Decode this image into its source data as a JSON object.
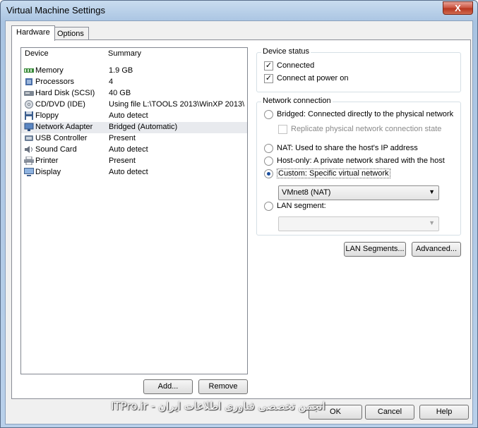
{
  "window": {
    "title": "Virtual Machine Settings",
    "close_label": "X"
  },
  "tabs": [
    {
      "label": "Hardware"
    },
    {
      "label": "Options"
    }
  ],
  "device_list": {
    "col_device": "Device",
    "col_summary": "Summary",
    "items": [
      {
        "name": "Memory",
        "summary": "1.9 GB",
        "icon": "memory-icon"
      },
      {
        "name": "Processors",
        "summary": "4",
        "icon": "processor-icon"
      },
      {
        "name": "Hard Disk (SCSI)",
        "summary": "40 GB",
        "icon": "hard-disk-icon"
      },
      {
        "name": "CD/DVD (IDE)",
        "summary": "Using file L:\\TOOLS 2013\\WinXP 2013\\...",
        "icon": "cd-dvd-icon"
      },
      {
        "name": "Floppy",
        "summary": "Auto detect",
        "icon": "floppy-icon"
      },
      {
        "name": "Network Adapter",
        "summary": "Bridged (Automatic)",
        "icon": "network-adapter-icon"
      },
      {
        "name": "USB Controller",
        "summary": "Present",
        "icon": "usb-icon"
      },
      {
        "name": "Sound Card",
        "summary": "Auto detect",
        "icon": "sound-card-icon"
      },
      {
        "name": "Printer",
        "summary": "Present",
        "icon": "printer-icon"
      },
      {
        "name": "Display",
        "summary": "Auto detect",
        "icon": "display-icon"
      }
    ]
  },
  "device_buttons": {
    "add": "Add...",
    "remove": "Remove"
  },
  "device_status": {
    "title": "Device status",
    "connected": "Connected",
    "connect_at_power_on": "Connect at power on"
  },
  "network_connection": {
    "title": "Network connection",
    "bridged": "Bridged: Connected directly to the physical network",
    "replicate": "Replicate physical network connection state",
    "nat": "NAT: Used to share the host's IP address",
    "host_only": "Host-only: A private network shared with the host",
    "custom": "Custom: Specific virtual network",
    "custom_selected_value": "VMnet8 (NAT)",
    "lan_segment": "LAN segment:",
    "lan_segment_value": ""
  },
  "network_buttons": {
    "lan_segments": "LAN Segments...",
    "advanced": "Advanced..."
  },
  "footer_buttons": {
    "ok": "OK",
    "cancel": "Cancel",
    "help": "Help"
  },
  "watermark": "ITPro.ir - انجمن تخصصی فناوری اطلاعات ایران"
}
